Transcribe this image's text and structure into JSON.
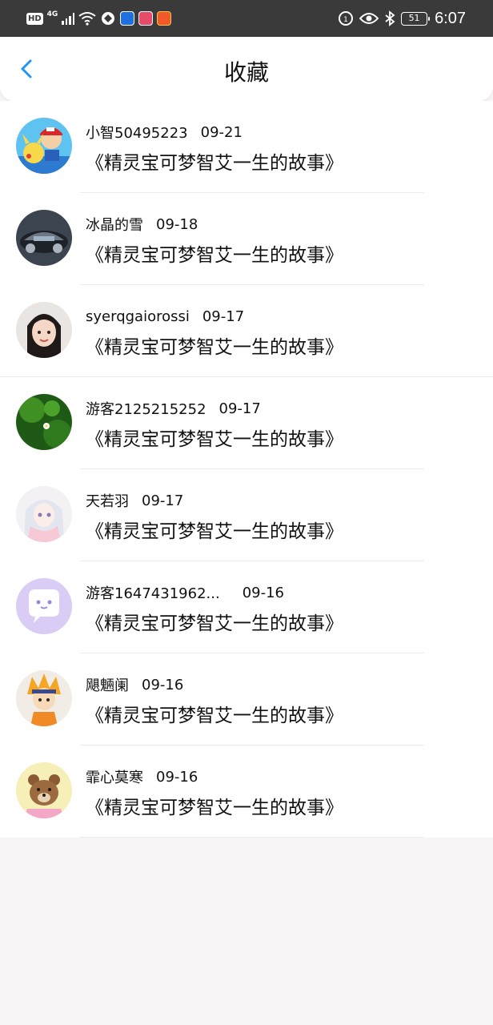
{
  "status_bar": {
    "hd": "HD",
    "network": "4G",
    "battery": "51",
    "time": "6:07"
  },
  "header": {
    "title": "收藏",
    "back_icon": "chevron-left-icon",
    "accent": "#2196f3"
  },
  "favorites": [
    {
      "user": "小智50495223",
      "date": "09-21",
      "title": "《精灵宝可梦智艾一生的故事》"
    },
    {
      "user": "冰晶的雪",
      "date": "09-18",
      "title": "《精灵宝可梦智艾一生的故事》"
    },
    {
      "user": "syerqgaiorossi",
      "date": "09-17",
      "title": "《精灵宝可梦智艾一生的故事》"
    },
    {
      "user": "游客2125215252",
      "date": "09-17",
      "title": "《精灵宝可梦智艾一生的故事》"
    },
    {
      "user": "天若羽",
      "date": "09-17",
      "title": "《精灵宝可梦智艾一生的故事》"
    },
    {
      "user": "游客1647431962...",
      "date": "09-16",
      "title": "《精灵宝可梦智艾一生的故事》"
    },
    {
      "user": "飓魎阑",
      "date": "09-16",
      "title": "《精灵宝可梦智艾一生的故事》"
    },
    {
      "user": "霏心莫寒",
      "date": "09-16",
      "title": "《精灵宝可梦智艾一生的故事》"
    }
  ]
}
